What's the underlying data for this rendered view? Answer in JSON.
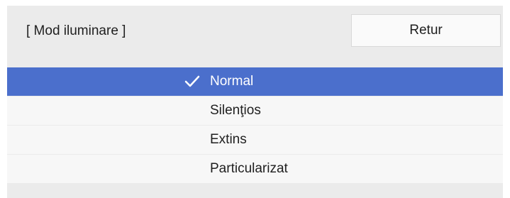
{
  "dialog": {
    "title": "[ Mod iluminare ]",
    "back_label": "Retur"
  },
  "options": [
    {
      "label": "Normal",
      "selected": true
    },
    {
      "label": "Silenţios",
      "selected": false
    },
    {
      "label": "Extins",
      "selected": false
    },
    {
      "label": "Particularizat",
      "selected": false
    }
  ],
  "colors": {
    "panel_background": "#ebebeb",
    "selected_background": "#4b6fcc",
    "option_background": "#f7f7f7",
    "text": "#1f1f1f",
    "selected_text": "#ffffff"
  },
  "icons": {
    "selected_marker": "check-icon"
  }
}
